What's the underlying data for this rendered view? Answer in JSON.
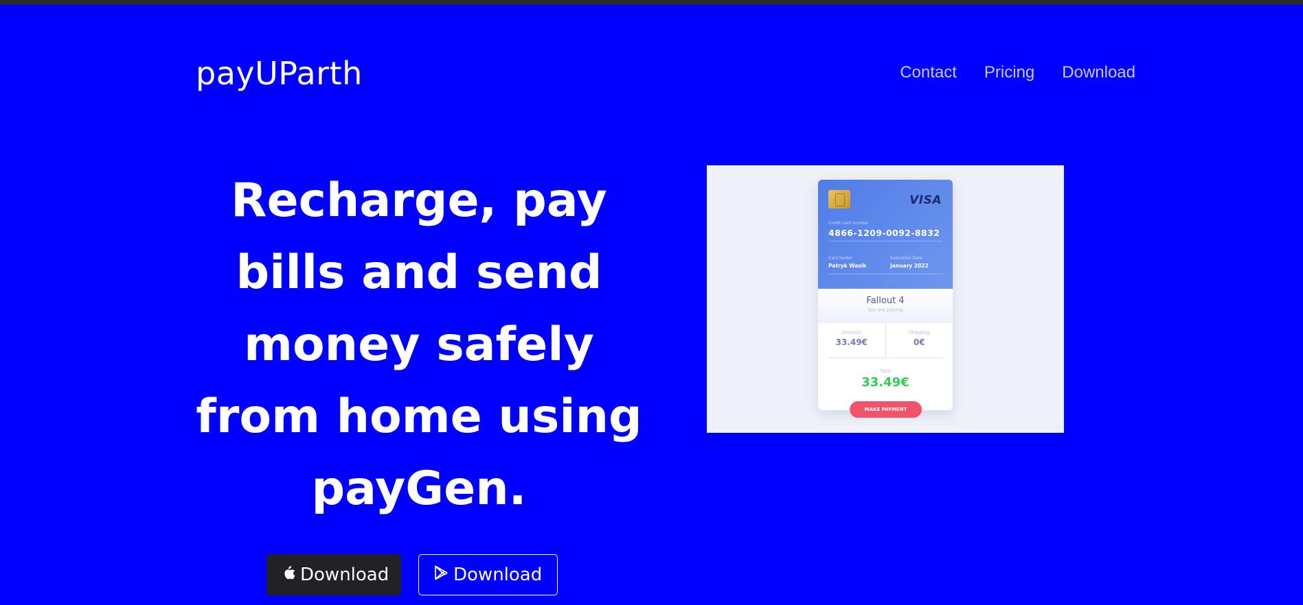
{
  "brand": "payUParth",
  "nav": {
    "items": [
      "Contact",
      "Pricing",
      "Download"
    ]
  },
  "hero": {
    "headline": "Recharge, pay bills and send money safely from home using payGen.",
    "buttons": {
      "apple_label": "Download",
      "play_label": "Download"
    }
  },
  "mockup": {
    "card_brand": "VISA",
    "card_number_label": "Credit card number",
    "card_number": "4866-1209-0092-8832",
    "card_holder_label": "Card holder",
    "card_holder": "Patryk Wasik",
    "expiration_label": "Expiration Date",
    "expiration": "January 2022",
    "product": "Fallout 4",
    "product_sub": "You are paying",
    "amount_label": "Amount",
    "amount": "33.49€",
    "shipping_label": "Shipping",
    "shipping": "0€",
    "total_label": "Total",
    "total": "33.49€",
    "pay_button": "MAKE PAYMENT"
  },
  "colors": {
    "background": "#0000ff",
    "nav_link": "#c9c9ff",
    "dark_button": "#222226",
    "total": "#2fcf4f",
    "pay_button": "#f2536a"
  }
}
